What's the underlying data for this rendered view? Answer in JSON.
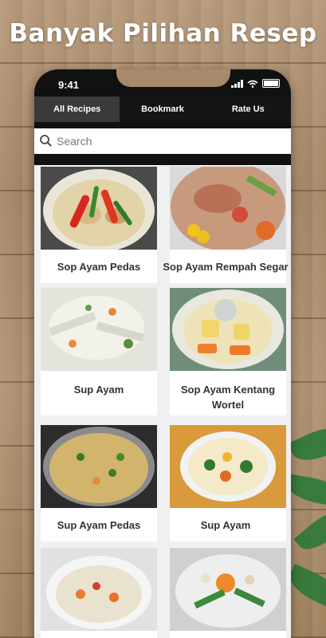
{
  "headline": "Banyak Pilihan Resep",
  "status": {
    "time": "9:41"
  },
  "tabs": [
    {
      "label": "All Recipes",
      "active": true
    },
    {
      "label": "Bookmark",
      "active": false
    },
    {
      "label": "Rate Us",
      "active": false
    }
  ],
  "search": {
    "placeholder": "Search"
  },
  "recipes": [
    {
      "title": "Sop Ayam Pedas"
    },
    {
      "title": "Sop Ayam Rempah Segar"
    },
    {
      "title": "Sup Ayam"
    },
    {
      "title": "Sop Ayam Kentang Wortel"
    },
    {
      "title": "Sup Ayam Pedas"
    },
    {
      "title": "Sup Ayam"
    }
  ],
  "colors": {
    "tabbar": "#151515",
    "active_tab": "#3a3a3a",
    "background_wood": "#a88a6b",
    "leaf": "#2f7a3a"
  }
}
